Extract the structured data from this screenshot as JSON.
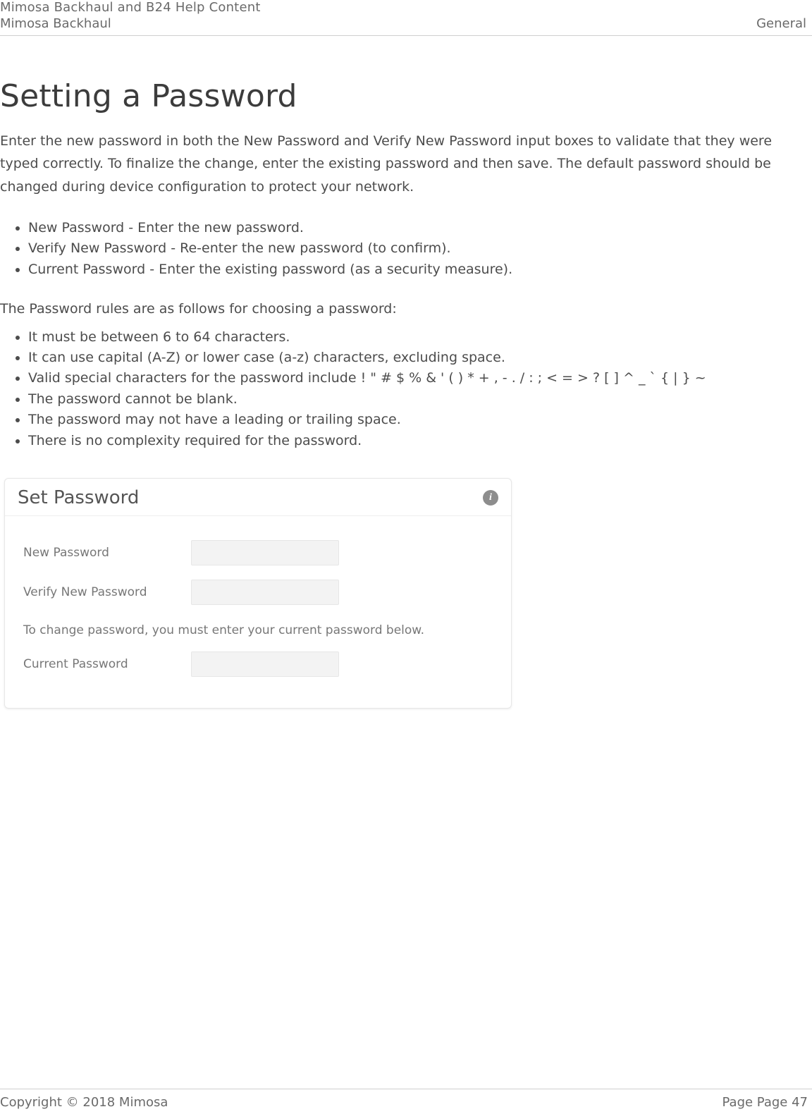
{
  "header": {
    "line1": "Mimosa Backhaul and B24 Help Content",
    "line2_left": "Mimosa Backhaul",
    "line2_right": "General"
  },
  "title": "Setting a Password",
  "intro": "Enter the new password in both the New Password and Verify New Password input boxes to validate that they were typed correctly. To finalize the change, enter the existing password and then save. The default password should be changed during device configuration to protect your network.",
  "first_list": [
    "New Password - Enter the new password.",
    "Verify New Password - Re-enter the new password (to confirm).",
    "Current Password - Enter the existing password (as a security measure)."
  ],
  "rules_intro": "The Password rules are as follows for choosing a password:",
  "rules_list": [
    "It must be between 6 to 64 characters.",
    "It can use capital (A-Z) or lower case (a-z) characters, excluding space.",
    "Valid special characters for the password include ! \" # $ % & ' ( ) * + , - . / : ; < = > ? [ ] ^ _ ` { | } ~",
    "The password cannot be blank.",
    "The password may not have a leading or trailing space.",
    "There is no complexity required for the password."
  ],
  "panel": {
    "title": "Set Password",
    "info_glyph": "i",
    "new_password_label": "New Password",
    "verify_label": "Verify New Password",
    "note": "To change password, you must enter your current password below.",
    "current_label": "Current Password"
  },
  "footer": {
    "left": "Copyright © 2018 Mimosa",
    "right": "Page Page 47"
  }
}
